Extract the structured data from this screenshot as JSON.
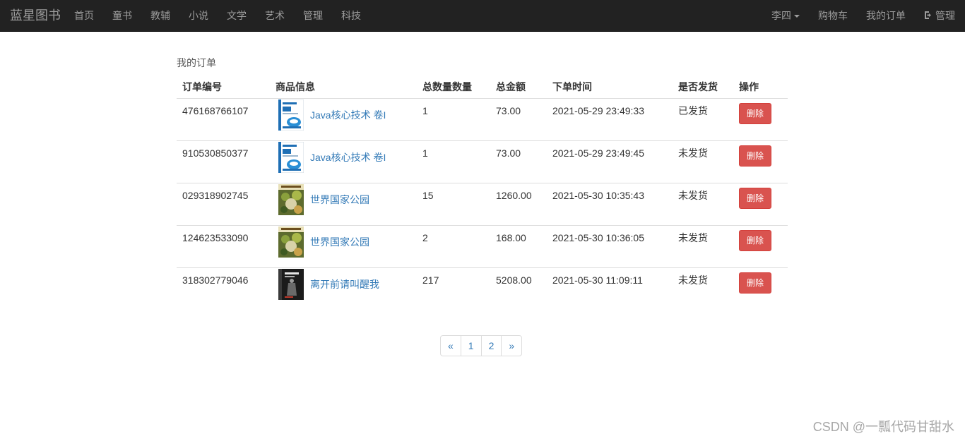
{
  "navbar": {
    "brand": "蓝星图书",
    "left_items": [
      "首页",
      "童书",
      "教辅",
      "小说",
      "文学",
      "艺术",
      "管理",
      "科技"
    ],
    "user": "李四",
    "cart": "购物车",
    "my_orders": "我的订单",
    "admin": "管理"
  },
  "page": {
    "title": "我的订单"
  },
  "table": {
    "headers": [
      "订单编号",
      "商品信息",
      "总数量数量",
      "总金额",
      "下单时间",
      "是否发货",
      "操作"
    ],
    "rows": [
      {
        "order_no": "476168766107",
        "product": "Java核心技术 卷I",
        "cover": "java",
        "qty": "1",
        "amount": "73.00",
        "time": "2021-05-29 23:49:33",
        "shipped": "已发货",
        "action": "删除"
      },
      {
        "order_no": "910530850377",
        "product": "Java核心技术 卷I",
        "cover": "java",
        "qty": "1",
        "amount": "73.00",
        "time": "2021-05-29 23:49:45",
        "shipped": "未发货",
        "action": "删除"
      },
      {
        "order_no": "029318902745",
        "product": "世界国家公园",
        "cover": "park",
        "qty": "15",
        "amount": "1260.00",
        "time": "2021-05-30 10:35:43",
        "shipped": "未发货",
        "action": "删除"
      },
      {
        "order_no": "124623533090",
        "product": "世界国家公园",
        "cover": "park",
        "qty": "2",
        "amount": "168.00",
        "time": "2021-05-30 10:36:05",
        "shipped": "未发货",
        "action": "删除"
      },
      {
        "order_no": "318302779046",
        "product": "离开前请叫醒我",
        "cover": "dark",
        "qty": "217",
        "amount": "5208.00",
        "time": "2021-05-30 11:09:11",
        "shipped": "未发货",
        "action": "删除"
      }
    ]
  },
  "pagination": {
    "prev": "«",
    "pages": [
      "1",
      "2"
    ],
    "next": "»"
  },
  "watermark": "CSDN @一瓢代码甘甜水",
  "colors": {
    "navbar_bg": "#222222",
    "link": "#337ab7",
    "danger": "#d9534f"
  }
}
